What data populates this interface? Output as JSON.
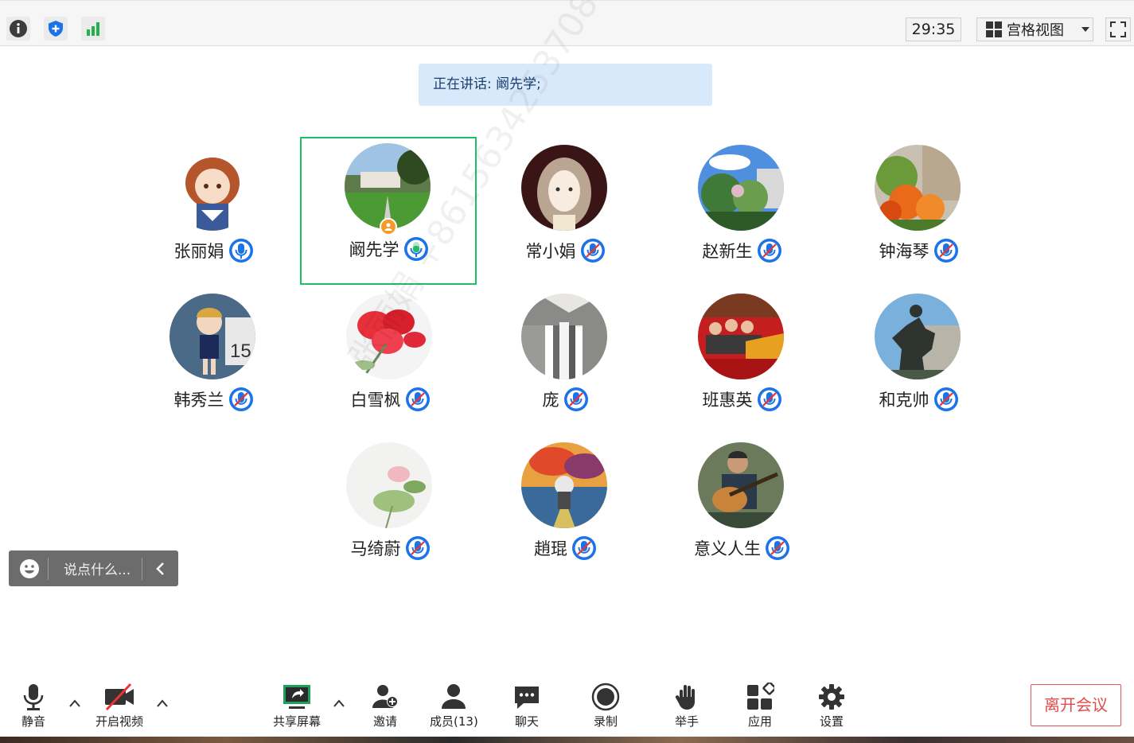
{
  "topbar": {
    "timer": "29:35",
    "view_label": "宫格视图"
  },
  "speaking": {
    "text": "正在讲话: 阚先学;"
  },
  "participants": [
    {
      "name": "张丽娟",
      "mic": "active-blue"
    },
    {
      "name": "阚先学",
      "mic": "active-green",
      "host": true,
      "speaking": true
    },
    {
      "name": "常小娟",
      "mic": "muted"
    },
    {
      "name": "赵新生",
      "mic": "muted"
    },
    {
      "name": "钟海琴",
      "mic": "muted"
    },
    {
      "name": "韩秀兰",
      "mic": "muted"
    },
    {
      "name": "白雪枫",
      "mic": "muted"
    },
    {
      "name": "庞",
      "mic": "muted"
    },
    {
      "name": "班惠英",
      "mic": "muted"
    },
    {
      "name": "和克帅",
      "mic": "muted"
    },
    {
      "name": "马绮蔚",
      "mic": "muted"
    },
    {
      "name": "趙琨",
      "mic": "muted"
    },
    {
      "name": "意义人生",
      "mic": "muted"
    }
  ],
  "chat": {
    "placeholder": "说点什么..."
  },
  "watermark": "张丽娟 +8615634253708",
  "toolbar": {
    "mute": "静音",
    "video": "开启视频",
    "share": "共享屏幕",
    "invite": "邀请",
    "members": "成员(13)",
    "chat": "聊天",
    "record": "录制",
    "raise_hand": "举手",
    "apps": "应用",
    "settings": "设置",
    "leave": "离开会议"
  },
  "colors": {
    "accent_blue": "#1a73e8",
    "speaking_green": "#1fbf6a",
    "leave_red": "#e24b4b",
    "banner_bg": "#d9e9fc"
  }
}
